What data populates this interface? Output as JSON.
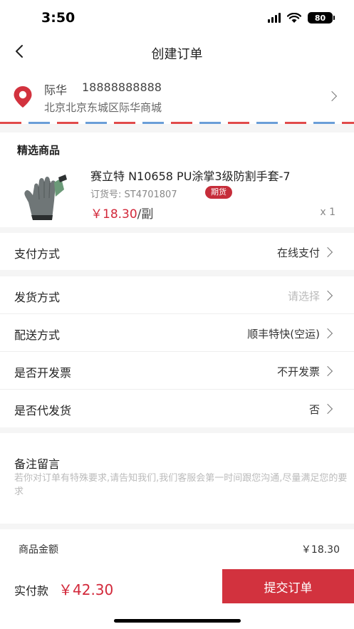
{
  "status_bar": {
    "time": "3:50",
    "battery": "80"
  },
  "nav": {
    "title": "创建订单",
    "back_icon": "chevron-left-icon"
  },
  "address": {
    "name": "际华",
    "phone": "18888888888",
    "detail": "北京北京东城区际华商城"
  },
  "products": {
    "section_title": "精选商品",
    "items": [
      {
        "name": "赛立特 N10658 PU涂掌3级防割手套-7",
        "code_label": "订货号: ST4701807",
        "badge": "期货",
        "price": "￥18.30",
        "unit": "/副",
        "quantity": "x 1"
      }
    ]
  },
  "payment": {
    "label": "支付方式",
    "value": "在线支付"
  },
  "options": [
    {
      "label": "发货方式",
      "value": "请选择",
      "placeholder": true
    },
    {
      "label": "配送方式",
      "value": "顺丰特快(空运)"
    },
    {
      "label": "是否开发票",
      "value": "不开发票"
    },
    {
      "label": "是否代发货",
      "value": "否"
    }
  ],
  "remark": {
    "title": "备注留言",
    "placeholder": "若你对订单有特殊要求,请告知我们,我们客服会第一时间跟您沟通,尽量满足您的要求"
  },
  "summary": {
    "label": "商品金额",
    "value": "￥18.30"
  },
  "footer": {
    "pay_label": "实付款",
    "pay_amount": "￥42.30",
    "submit_label": "提交订单"
  },
  "colors": {
    "accent": "#d2323e",
    "price": "#d2283a",
    "envelope_red": "#e14a4a",
    "envelope_blue": "#6a9ed8"
  }
}
